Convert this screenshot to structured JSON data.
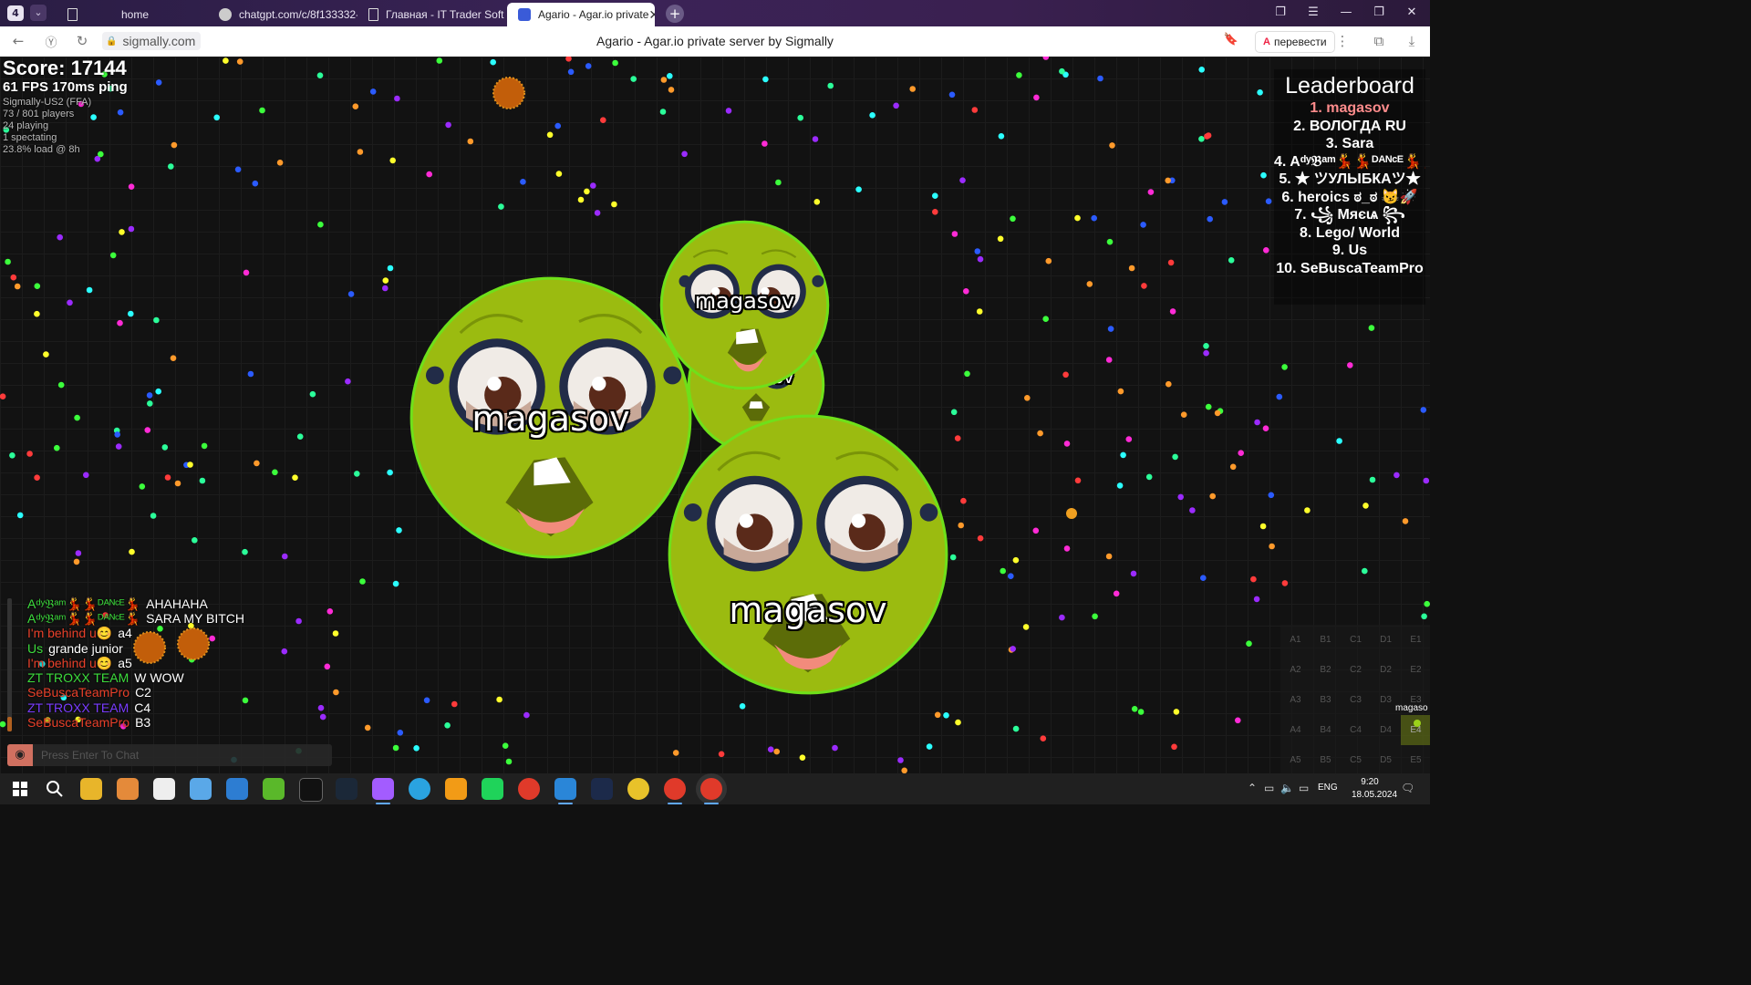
{
  "browser": {
    "tab_count": "4",
    "tabs": [
      {
        "label": "home",
        "icon": "document-icon"
      },
      {
        "label": "chatgpt.com/c/8f133332-",
        "icon": "chatgpt-icon"
      },
      {
        "label": "Главная - IT Trader Soft",
        "icon": "document-icon"
      },
      {
        "label": "Agario - Agar.io private",
        "icon": "sigmally-icon"
      }
    ],
    "url": "sigmally.com",
    "page_title": "Agario - Agar.io private server by Sigmally",
    "translate_label": "перевести"
  },
  "hud": {
    "score": "Score: 17144",
    "fps": "61 FPS 170ms ping",
    "server": "Sigmally-US2 (FFA)",
    "players": "73 / 801 players",
    "playing": "24 playing",
    "spectating": "1 spectating",
    "load": "23.8% load @ 8h"
  },
  "leaderboard": {
    "title": "Leaderboard",
    "entries": [
      "1. magasov",
      "2. ВОЛОГДА RU",
      "3. Sara",
      "4. Aᵈʸ𝔅ᵃᵐ💃💃ᴰᴬᴺᶜᴱ💃💃",
      "5. ★ ツУЛЫБКАツ★",
      "6. heroics ಠ_ಠ 😼🚀",
      "7. ꧁ Mᴙєɩѧ ꧂",
      "8. Lego/ World",
      "9. Us",
      "10. SeBuscaTeamPro"
    ]
  },
  "cells": [
    {
      "name": "magasov"
    },
    {
      "name": "magasov"
    },
    {
      "name": "magasov"
    },
    {
      "name": "magasov"
    }
  ],
  "chat": {
    "messages": [
      {
        "author": "Aᵈʸ𝔅ᵃᵐ💃💃ᴰᴬᴺᶜᴱ💃",
        "text": "AHAHAHA",
        "color": "#3cdc3c"
      },
      {
        "author": "Aᵈʸ𝔅ᵃᵐ💃💃ᴰᴬᴺᶜᴱ💃",
        "text": "SARA MY BITCH",
        "color": "#3cdc3c"
      },
      {
        "author": "I'm behind u😊",
        "text": "a4",
        "color": "#e8402a"
      },
      {
        "author": "Us",
        "text": "grande junior",
        "color": "#3cdc3c"
      },
      {
        "author": "I'm behind u😊",
        "text": "a5",
        "color": "#e8402a"
      },
      {
        "author": "ZT TROXX TEAM",
        "text": "W  WOW",
        "color": "#3cdc3c"
      },
      {
        "author": "SeBuscaTeamPro",
        "text": "C2",
        "color": "#e8402a"
      },
      {
        "author": "ZT TROXX TEAM",
        "text": "C4",
        "color": "#7a3cff"
      },
      {
        "author": "SeBuscaTeamPro",
        "text": "B3",
        "color": "#e8402a"
      }
    ],
    "placeholder": "Press Enter To Chat"
  },
  "minimap": {
    "rows": [
      [
        "A1",
        "B1",
        "C1",
        "D1",
        "E1"
      ],
      [
        "A2",
        "B2",
        "C2",
        "D2",
        "E2"
      ],
      [
        "A3",
        "B3",
        "C3",
        "D3",
        "E3"
      ],
      [
        "A4",
        "B4",
        "C4",
        "D4",
        "E4"
      ],
      [
        "A5",
        "B5",
        "C5",
        "D5",
        "E5"
      ]
    ],
    "player_label": "magaso",
    "active_cell": "E4"
  },
  "taskbar": {
    "language": "ENG",
    "time": "9:20",
    "date": "18.05.2024"
  },
  "colors": {
    "cell_fill": "#9bbb10",
    "cell_border": "#6fe01a",
    "virus": "#c25e0a",
    "tabbar": "#2a1d44",
    "leaderboard_me": "#ff8c8c"
  }
}
